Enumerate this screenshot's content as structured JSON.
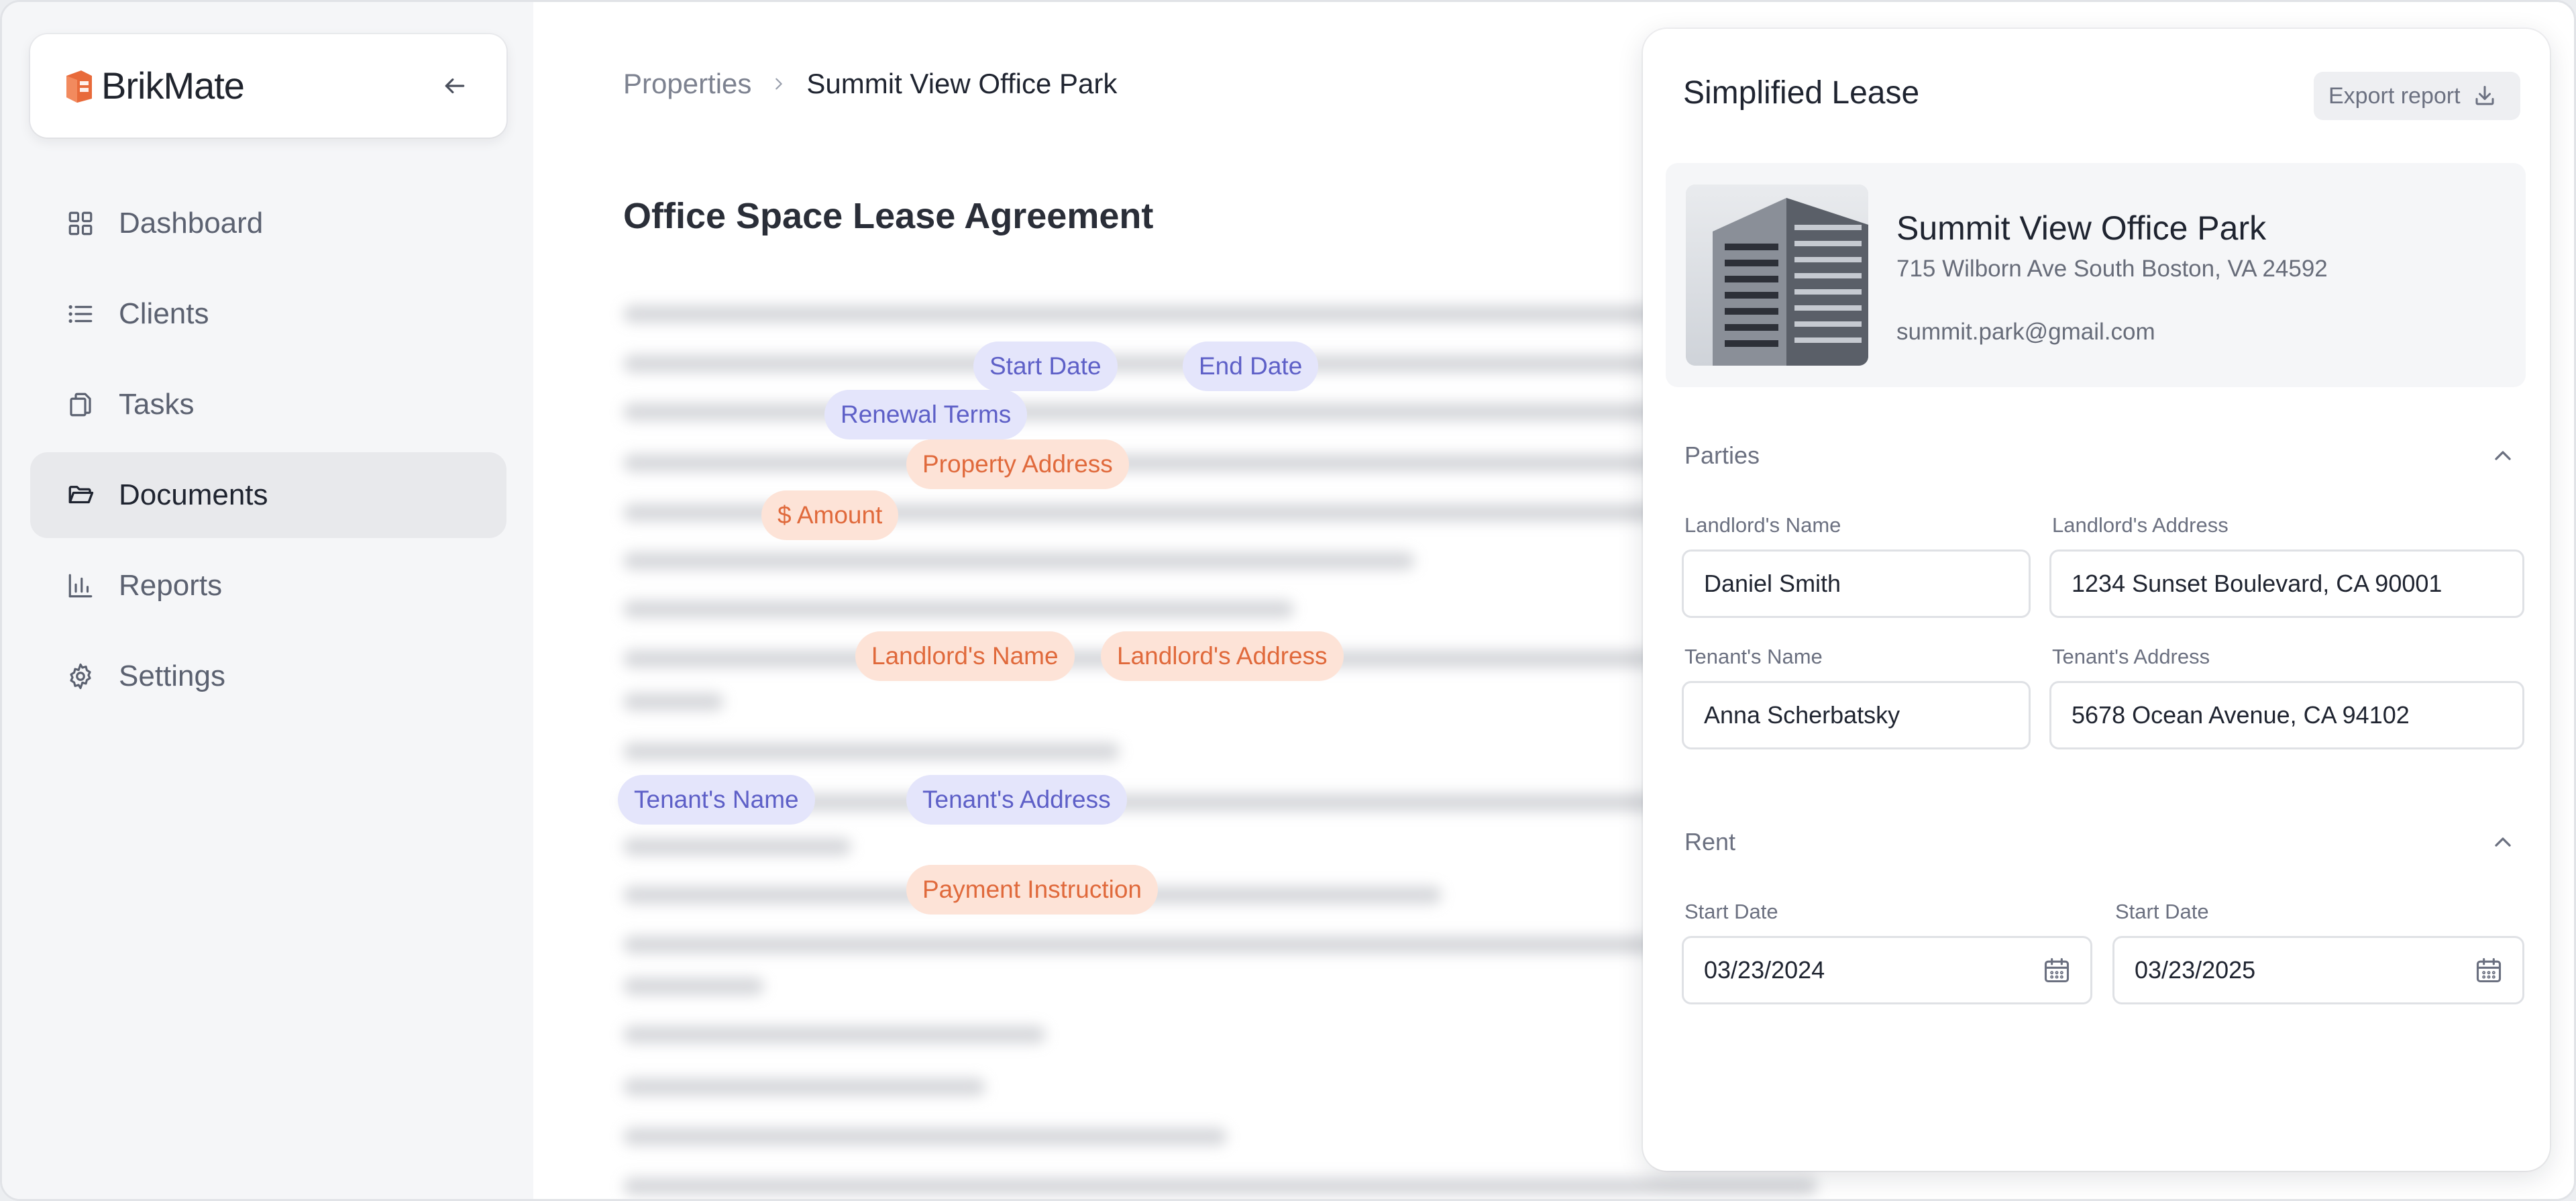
{
  "app": {
    "brand": "BrikMate",
    "accent": "#e86a3a"
  },
  "sidebar": {
    "items": [
      {
        "label": "Dashboard",
        "icon": "grid-icon",
        "active": false
      },
      {
        "label": "Clients",
        "icon": "list-icon",
        "active": false
      },
      {
        "label": "Tasks",
        "icon": "copy-icon",
        "active": false
      },
      {
        "label": "Documents",
        "icon": "folder-icon",
        "active": true
      },
      {
        "label": "Reports",
        "icon": "bar-chart-icon",
        "active": false
      },
      {
        "label": "Settings",
        "icon": "gear-icon",
        "active": false
      }
    ]
  },
  "breadcrumb": {
    "parent": "Properties",
    "current": "Summit View Office Park"
  },
  "document": {
    "title": "Office Space Lease Agreement",
    "tags": {
      "start_date": "Start Date",
      "end_date": "End Date",
      "renewal_terms": "Renewal Terms",
      "property_address": "Property Address",
      "amount": "$ Amount",
      "landlords_name": "Landlord's Name",
      "landlords_address": "Landlord's Address",
      "tenants_name": "Tenant's Name",
      "tenants_address": "Tenant's Address",
      "payment_instruction": "Payment Instruction"
    },
    "tag_colors": {
      "blue_bg": "#e4e5fb",
      "blue_text": "#5d5fc7",
      "orange_bg": "#fde3d7",
      "orange_text": "#e0693b"
    }
  },
  "panel": {
    "title": "Simplified Lease",
    "export_label": "Export report",
    "property": {
      "name": "Summit View Office Park",
      "address": "715 Wilborn Ave South Boston, VA 24592",
      "email": "summit.park@gmail.com"
    },
    "parties": {
      "section_title": "Parties",
      "landlord_name_label": "Landlord's Name",
      "landlord_name": "Daniel Smith",
      "landlord_address_label": "Landlord's Address",
      "landlord_address": "1234 Sunset Boulevard, CA 90001",
      "tenant_name_label": "Tenant's Name",
      "tenant_name": "Anna Scherbatsky",
      "tenant_address_label": "Tenant's Address",
      "tenant_address": "5678 Ocean Avenue, CA 94102"
    },
    "rent": {
      "section_title": "Rent",
      "start_label_1": "Start Date",
      "start_value_1": "03/23/2024",
      "start_label_2": "Start Date",
      "start_value_2": "03/23/2025"
    }
  }
}
